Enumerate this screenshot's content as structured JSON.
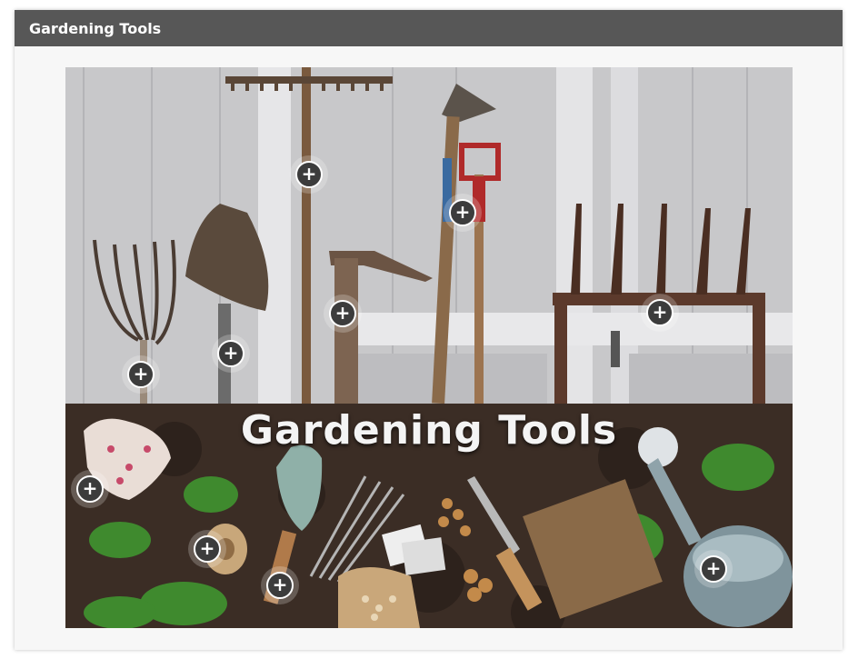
{
  "header": {
    "title": "Gardening Tools"
  },
  "image": {
    "caption": "Gardening Tools"
  },
  "hotspots": [
    {
      "name": "hotspot-rake",
      "symbol": "+"
    },
    {
      "name": "hotspot-hoe",
      "symbol": "+"
    },
    {
      "name": "hotspot-adze",
      "symbol": "+"
    },
    {
      "name": "hotspot-pitchfork-rack",
      "symbol": "+"
    },
    {
      "name": "hotspot-shovel",
      "symbol": "+"
    },
    {
      "name": "hotspot-garden-fork",
      "symbol": "+"
    },
    {
      "name": "hotspot-gardening-gloves",
      "symbol": "+"
    },
    {
      "name": "hotspot-twine-spool",
      "symbol": "+"
    },
    {
      "name": "hotspot-hand-trowel",
      "symbol": "+"
    },
    {
      "name": "hotspot-watering-can",
      "symbol": "+"
    }
  ],
  "colors": {
    "header_bg": "#575757",
    "card_bg": "#f7f7f7",
    "hotspot_fill": "#3c3c3c",
    "wall": "#c9c9cb",
    "soil": "#3b2d25"
  }
}
